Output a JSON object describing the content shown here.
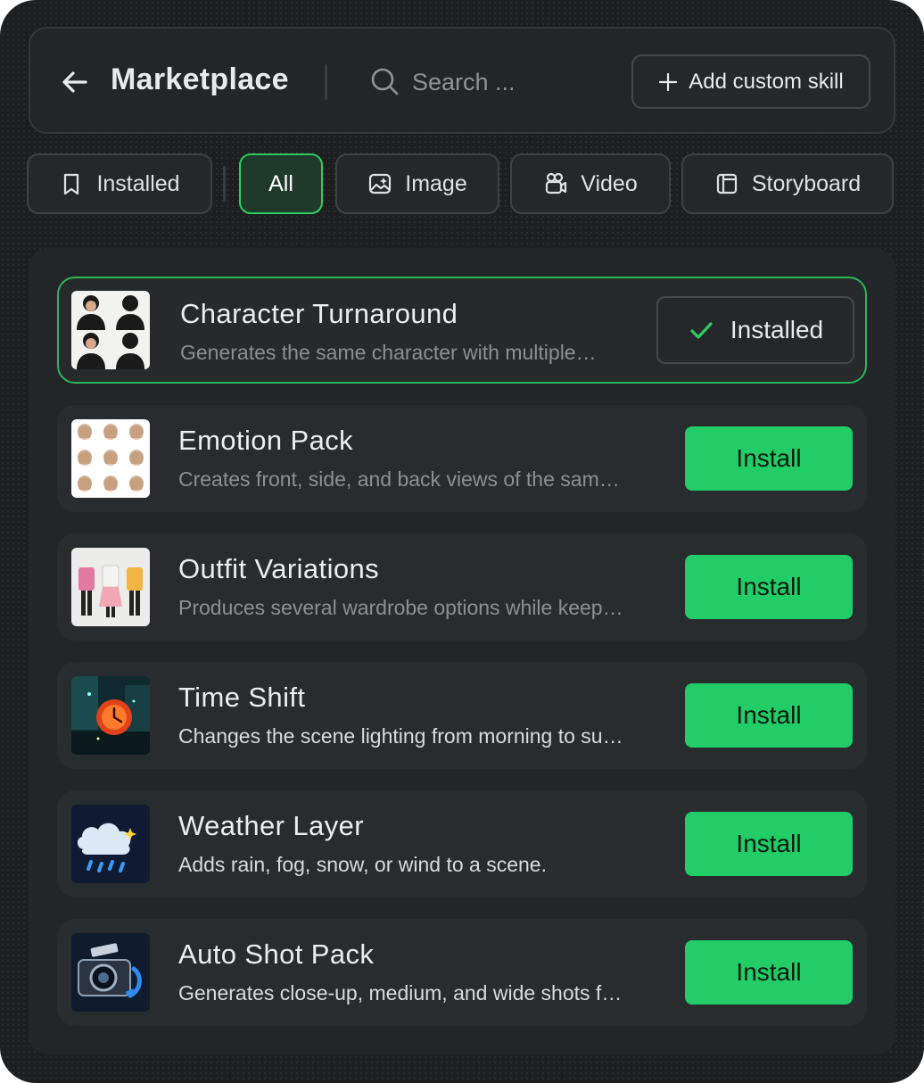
{
  "header": {
    "title": "Marketplace",
    "back_icon": "arrow-left-icon",
    "search_placeholder": "Search ...",
    "search_value": "",
    "add_button_label": "Add custom skill"
  },
  "tabs": [
    {
      "label": "Installed",
      "icon": "bookmark-icon",
      "active": false
    },
    {
      "label": "All",
      "icon": "",
      "active": true
    },
    {
      "label": "Image",
      "icon": "image-sparkle-icon",
      "active": false
    },
    {
      "label": "Video",
      "icon": "video-camera-icon",
      "active": false
    },
    {
      "label": "Storyboard",
      "icon": "storyboard-icon",
      "active": false
    }
  ],
  "skills": [
    {
      "title": "Character Turnaround",
      "description": "Generates the same character with multiple…",
      "status": "installed",
      "button_label": "Installed",
      "thumbnail": "character-turnaround-thumbnail"
    },
    {
      "title": "Emotion Pack",
      "description": "Creates front, side, and back views of the sam…",
      "status": "available",
      "button_label": "Install",
      "thumbnail": "emotion-pack-thumbnail"
    },
    {
      "title": "Outfit Variations",
      "description": "Produces several wardrobe options while keep…",
      "status": "available",
      "button_label": "Install",
      "thumbnail": "outfit-variations-thumbnail"
    },
    {
      "title": "Time Shift",
      "description": "Changes the scene lighting from morning to su…",
      "status": "available",
      "button_label": "Install",
      "thumbnail": "time-shift-thumbnail"
    },
    {
      "title": "Weather Layer",
      "description": "Adds rain, fog, snow, or wind to a scene.",
      "status": "available",
      "button_label": "Install",
      "thumbnail": "weather-layer-thumbnail"
    },
    {
      "title": "Auto Shot Pack",
      "description": "Generates close-up, medium, and wide shots f…",
      "status": "available",
      "button_label": "Install",
      "thumbnail": "auto-shot-pack-thumbnail"
    }
  ],
  "colors": {
    "accent": "#22cc66",
    "background": "#1c1e20",
    "panel": "#232629",
    "card": "#292c2f"
  }
}
